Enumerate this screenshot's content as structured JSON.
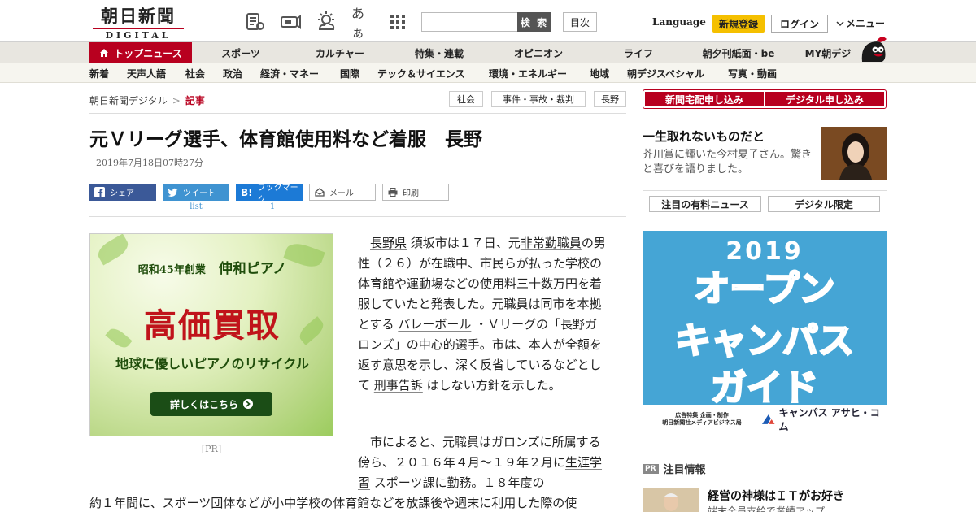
{
  "header": {
    "logo_main": "朝日新聞",
    "logo_sub": "DIGITAL",
    "icons": [
      "news-paper-icon",
      "megaphone-icon",
      "weather-icon",
      "font-size-icon",
      "grid-menu-icon"
    ],
    "font_size_glyph": "あぁ",
    "search_placeholder": "",
    "search_button": "検 索",
    "index_button": "目次",
    "language": "Language",
    "signup": "新規登録",
    "login": "ログイン",
    "menu": "メニュー"
  },
  "nav1": {
    "top_news": "トップニュース",
    "items": [
      "スポーツ",
      "カルチャー",
      "特集・連載",
      "オピニオン",
      "ライフ",
      "朝夕刊紙面・be",
      "MY朝デジ"
    ]
  },
  "nav2": {
    "items": [
      "新着",
      "天声人語",
      "社会",
      "政治",
      "経済・マネー",
      "国際",
      "テック＆サイエンス",
      "環境・エネルギー",
      "地域",
      "朝デジスペシャル",
      "写真・動画"
    ]
  },
  "breadcrumb": {
    "home": "朝日新聞デジタル",
    "separator": ">",
    "current": "記事"
  },
  "tags": [
    "社会",
    "事件・事故・裁判",
    "長野"
  ],
  "article": {
    "title": "元Ｖリーグ選手、体育館使用料など着服　長野",
    "date": "2019年7月18日07時27分",
    "share": {
      "facebook": "シェア",
      "twitter": "ツイート",
      "twitter_count": "list",
      "hatena": "ブックマーク",
      "hatena_count": "1",
      "mail": "メール",
      "print": "印刷"
    },
    "p1_link1": "長野県",
    "p1_a": "須坂市は１７日、元",
    "p1_link2": "非常勤職員",
    "p1_b": "の男性（２６）が在職中、市民らが払った学校の体育館や運動場などの使用料三十数万円を着服していたと発表した。元職員は同市を本拠とする",
    "p1_link3": "バレーボール",
    "p1_c": "・Ｖリーグの「長野ガロンズ」の中心的選手。市は、本人が全額を返す意思を示し、深く反省しているなどとして",
    "p1_link4": "刑事告訴",
    "p1_d": "はしない方針を示した。",
    "p2_a": "市によると、元職員はガロンズに所属する傍ら、２０１６年４月～１９年２月に",
    "p2_link": "生涯学習",
    "p2_b": "スポーツ課に勤務。１８年度の",
    "p2_wide": "約１年間に、スポーツ団体などが小中学校の体育館などを放課後や週末に利用した際の使"
  },
  "ad_left": {
    "est": "昭和45年創業",
    "brand": "伸和ピアノ",
    "headline": "高価買取",
    "tagline": "地球に優しいピアノのリサイクル",
    "button": "詳しくはこちら",
    "pr": "[PR]"
  },
  "right": {
    "btn_paper": "新聞宅配申し込み",
    "btn_digital": "デジタル申し込み",
    "feature_title": "一生取れないものだと",
    "feature_text": "芥川賞に輝いた今村夏子さん。驚きと喜びを語りました。",
    "tab_paid": "注目の有料ニュース",
    "tab_digital": "デジタル限定",
    "attention_badge": "PR",
    "attention_label": "注目情報",
    "attention_title": "経営の神様はＩＴがお好き",
    "attention_sub": "端末全員支給で業績アップ"
  },
  "ad_right": {
    "year": "2019",
    "line1": "オープン",
    "line2": "キャンパス",
    "line3": "ガイド",
    "foot1": "広告特集 企画・制作",
    "foot2": "朝日新聞社メディアビジネス局",
    "brand": "キャンパス アサヒ・コム"
  },
  "colors": {
    "brand_red": "#b8001f",
    "signup_yellow": "#f5c000",
    "facebook": "#3b5998",
    "twitter": "#3f93d1",
    "hatena": "#1c7ad6",
    "ad_blue": "#45a5d5"
  }
}
